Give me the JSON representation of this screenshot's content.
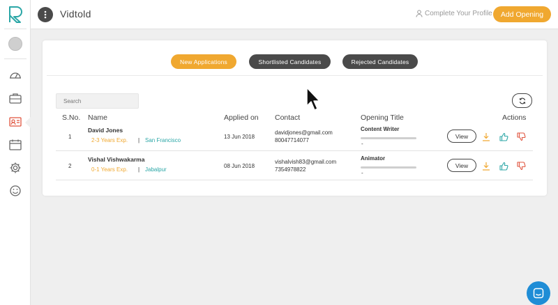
{
  "app": {
    "title": "Vidtold"
  },
  "topbar": {
    "profile_link": "Complete Your Profile",
    "add_opening": "Add Opening"
  },
  "colors": {
    "accent": "#f0a830",
    "dark": "#4a4a4a",
    "teal": "#2aa6a6",
    "chat": "#1f8dd6"
  },
  "sidebar": {
    "icons": [
      "logo-icon",
      "avatar",
      "dashboard-icon",
      "briefcase-icon",
      "id-card-icon",
      "calendar-icon",
      "gear-icon",
      "smiley-icon"
    ]
  },
  "tabs": [
    {
      "label": "New Applications"
    },
    {
      "label": "Shortlisted Candidates"
    },
    {
      "label": "Rejected Candidates"
    }
  ],
  "search": {
    "placeholder": "Search"
  },
  "table": {
    "headers": {
      "sno": "S.No.",
      "name": "Name",
      "applied": "Applied on",
      "contact": "Contact",
      "opening": "Opening Title",
      "actions": "Actions"
    },
    "rows": [
      {
        "sno": "1",
        "name": "David Jones",
        "exp": "2-3 Years Exp.",
        "sep": "|",
        "location": "San Francisco",
        "applied": "13 Jun 2018",
        "email": "davidjones@gmail.com",
        "phone": "80047714077",
        "opening": "Content Writer",
        "score": "-",
        "view": "View"
      },
      {
        "sno": "2",
        "name": "Vishal Vishwakarma",
        "exp": "0-1 Years Exp.",
        "sep": "|",
        "location": "Jabalpur",
        "applied": "08 Jun 2018",
        "email": "vishalvish83@gmail.com",
        "phone": "7354978822",
        "opening": "Animator",
        "score": "-",
        "view": "View"
      }
    ]
  }
}
